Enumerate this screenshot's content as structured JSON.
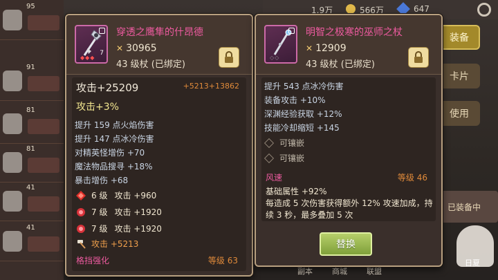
{
  "background": {
    "resources": [
      "1.9万",
      "566万",
      "647"
    ],
    "side_buttons": [
      "装备",
      "卡片",
      "使用"
    ],
    "list_levels": [
      "95",
      "91",
      "81",
      "81",
      "41",
      "41"
    ],
    "char_card_text": "已装备中",
    "avatar_name": "日夏",
    "bottom_labels": [
      "副本",
      "商城",
      "联盟"
    ]
  },
  "left_item": {
    "name": "穿透之鹰隼的什昂德",
    "power": "30965",
    "level": "43 级杖 (已绑定)",
    "attack_main": "攻击+25209",
    "attack_diff": "+5213+13862",
    "attack_pct": "攻击+3%",
    "stats": [
      "提升 159 点火焰伤害",
      "提升 147 点冰冷伤害",
      "对精英怪增伤 +70",
      "魔法物品搜寻 +18%",
      "暴击增伤 +68"
    ],
    "gems": [
      {
        "level": "6 级",
        "text": "攻击 +960"
      },
      {
        "level": "7 级",
        "text": "攻击 +1920"
      },
      {
        "level": "7 级",
        "text": "攻击 +1920"
      }
    ],
    "hammer_text": "攻击 +5213",
    "refine_label": "格挡强化",
    "refine_level": "等级 63"
  },
  "right_item": {
    "name": "明智之极寒的巫师之杖",
    "power": "12909",
    "level": "43 级杖 (已绑定)",
    "stats": [
      "提升 543 点冰冷伤害",
      "装备攻击 +10%",
      "深渊经验获取 +12%",
      "技能冷却缩短 +145"
    ],
    "sockets": [
      "可镶嵌",
      "可镶嵌"
    ],
    "skill_name": "风速",
    "skill_level": "等级 46",
    "skill_base": "基础属性 +92%",
    "skill_desc": "每造成 5 次伤害获得额外 12% 攻速加成，持续 3 秒，最多叠加 5 次",
    "replace_label": "替换"
  }
}
